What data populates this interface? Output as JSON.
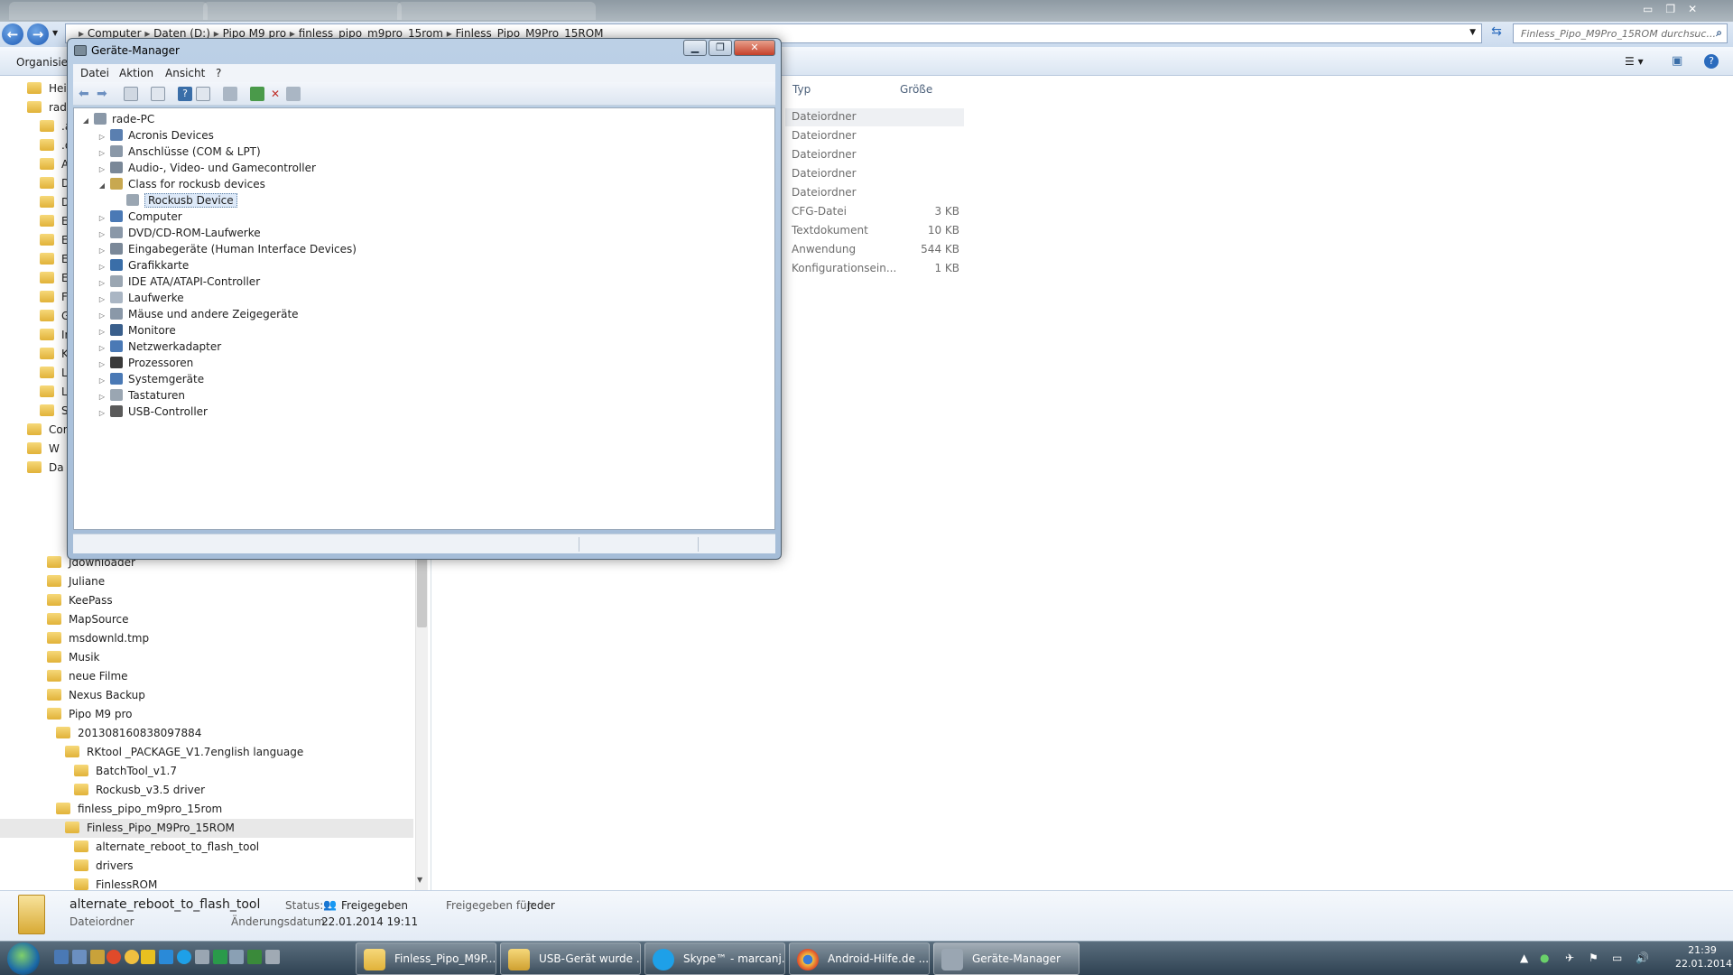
{
  "explorer": {
    "path": [
      "Computer",
      "Daten (D:)",
      "Pipo M9 pro",
      "finless_pipo_m9pro_15rom",
      "Finless_Pipo_M9Pro_15ROM"
    ],
    "search_placeholder": "Finless_Pipo_M9Pro_15ROM durchsuc...",
    "organize_label": "Organisieren",
    "nav_top": [
      {
        "label": "Hei"
      },
      {
        "label": "rade"
      },
      {
        "label": ".a"
      },
      {
        "label": ".o"
      },
      {
        "label": "Ap"
      },
      {
        "label": "De"
      },
      {
        "label": "Do"
      },
      {
        "label": "Ei"
      },
      {
        "label": "Ei"
      },
      {
        "label": "Ei"
      },
      {
        "label": "Ei"
      },
      {
        "label": "Fa"
      },
      {
        "label": "Ge"
      },
      {
        "label": "In"
      },
      {
        "label": "Ko"
      },
      {
        "label": "Li"
      },
      {
        "label": "Lo"
      },
      {
        "label": "Su"
      },
      {
        "label": "Con"
      },
      {
        "label": "W"
      },
      {
        "label": "Da"
      }
    ],
    "nav_items": [
      {
        "label": "Jdownloader"
      },
      {
        "label": "Juliane"
      },
      {
        "label": "KeePass"
      },
      {
        "label": "MapSource"
      },
      {
        "label": "msdownld.tmp"
      },
      {
        "label": "Musik"
      },
      {
        "label": "neue Filme"
      },
      {
        "label": "Nexus Backup"
      },
      {
        "label": "Pipo M9 pro"
      },
      {
        "label": "20130816083809788‌4"
      },
      {
        "label": "RKtool _PACKAGE_V1.7english language"
      },
      {
        "label": "BatchTool_v1.7"
      },
      {
        "label": "Rockusb_v3.5 driver"
      },
      {
        "label": "finless_pipo_m9pro_15rom"
      },
      {
        "label": "Finless_Pipo_M9Pro_15ROM"
      },
      {
        "label": "alternate_reboot_to_flash_tool"
      },
      {
        "label": "drivers"
      },
      {
        "label": "FinlessROM"
      }
    ],
    "columns": {
      "type": "Typ",
      "size": "Größe"
    },
    "rows": [
      {
        "type": "Dateiordner",
        "size": ""
      },
      {
        "type": "Dateiordner",
        "size": ""
      },
      {
        "type": "Dateiordner",
        "size": ""
      },
      {
        "type": "Dateiordner",
        "size": ""
      },
      {
        "type": "Dateiordner",
        "size": ""
      },
      {
        "type": "CFG-Datei",
        "size": "3 KB"
      },
      {
        "type": "Textdokument",
        "size": "10 KB"
      },
      {
        "type": "Anwendung",
        "size": "544 KB"
      },
      {
        "type": "Konfigurationsein...",
        "size": "1 KB"
      }
    ],
    "details": {
      "name": "alternate_reboot_to_flash_tool",
      "kind": "Dateiordner",
      "status_label": "Status:",
      "status_value": "Freigegeben",
      "date_label": "Änderungsdatum:",
      "date_value": "22.01.2014 19:11",
      "shared_label": "Freigegeben für:",
      "shared_value": "Jeder"
    }
  },
  "device_manager": {
    "title": "Geräte-Manager",
    "menu": [
      "Datei",
      "Aktion",
      "Ansicht",
      "?"
    ],
    "root": "rade-PC",
    "nodes": [
      {
        "label": "Acronis Devices",
        "exp": "▷"
      },
      {
        "label": "Anschlüsse (COM & LPT)",
        "exp": "▷"
      },
      {
        "label": "Audio-, Video- und Gamecontroller",
        "exp": "▷"
      },
      {
        "label": "Class for rockusb devices",
        "exp": "◢"
      },
      {
        "label": "Rockusb Device",
        "exp": ""
      },
      {
        "label": "Computer",
        "exp": "▷"
      },
      {
        "label": "DVD/CD-ROM-Laufwerke",
        "exp": "▷"
      },
      {
        "label": "Eingabegeräte (Human Interface Devices)",
        "exp": "▷"
      },
      {
        "label": "Grafikkarte",
        "exp": "▷"
      },
      {
        "label": "IDE ATA/ATAPI-Controller",
        "exp": "▷"
      },
      {
        "label": "Laufwerke",
        "exp": "▷"
      },
      {
        "label": "Mäuse und andere Zeigegeräte",
        "exp": "▷"
      },
      {
        "label": "Monitore",
        "exp": "▷"
      },
      {
        "label": "Netzwerkadapter",
        "exp": "▷"
      },
      {
        "label": "Prozessoren",
        "exp": "▷"
      },
      {
        "label": "Systemgeräte",
        "exp": "▷"
      },
      {
        "label": "Tastaturen",
        "exp": "▷"
      },
      {
        "label": "USB-Controller",
        "exp": "▷"
      }
    ]
  },
  "taskbar": {
    "buttons": [
      {
        "label": "Finless_Pipo_M9P..."
      },
      {
        "label": "USB-Gerät wurde ..."
      },
      {
        "label": "Skype™ - marcanj..."
      },
      {
        "label": "Android-Hilfe.de ..."
      },
      {
        "label": "Geräte-Manager"
      }
    ],
    "time": "21:39",
    "date": "22.01.2014"
  },
  "colors": {
    "accent": "#2a6bbd",
    "folder": "#e1b239",
    "selection": "#dde9f8"
  }
}
